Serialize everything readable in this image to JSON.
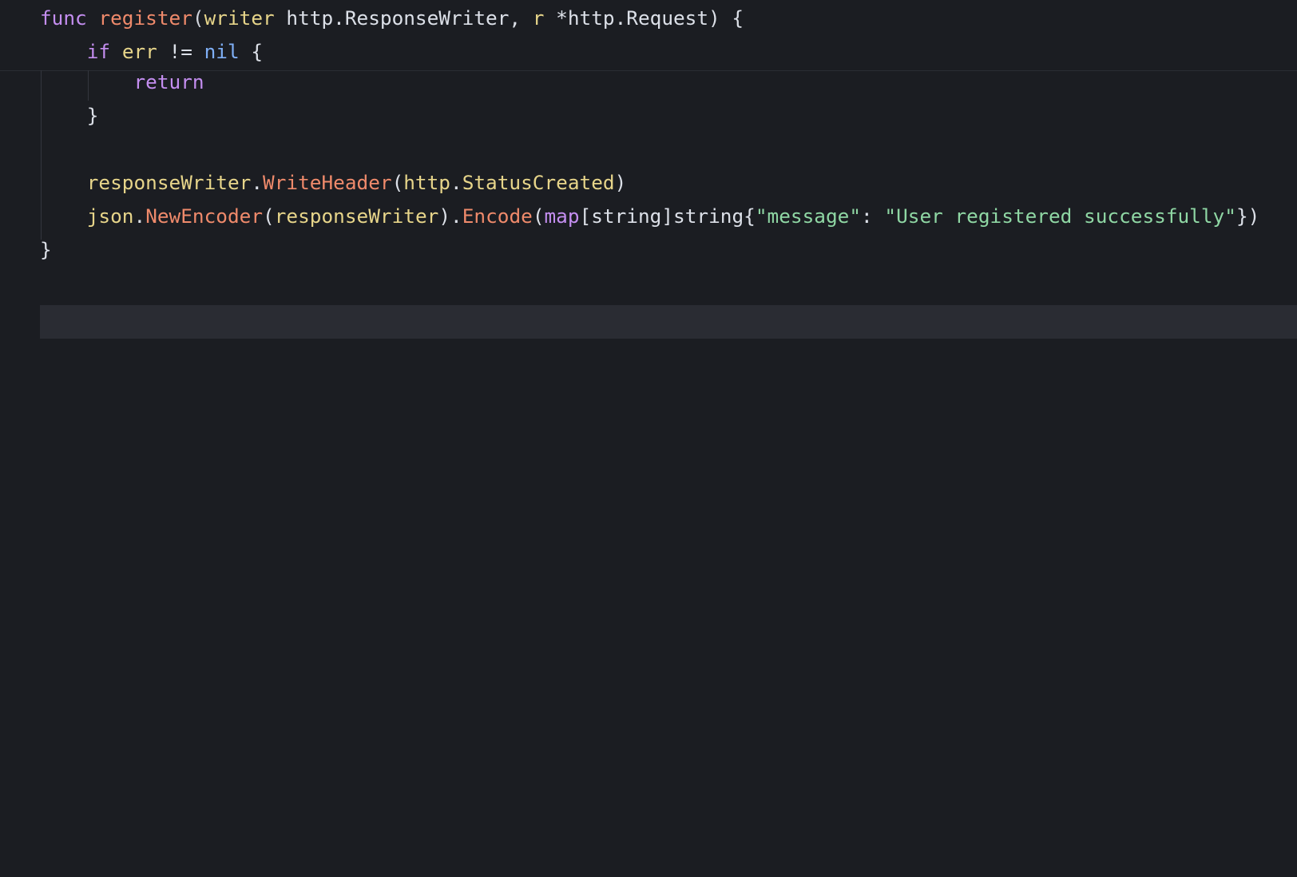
{
  "editor": {
    "lines": [
      {
        "tokens": [
          {
            "text": "func",
            "kind": "kw"
          },
          {
            "text": " ",
            "kind": "punct"
          },
          {
            "text": "register",
            "kind": "fn"
          },
          {
            "text": "(",
            "kind": "punct"
          },
          {
            "text": "writer",
            "kind": "param"
          },
          {
            "text": " http.ResponseWriter, ",
            "kind": "ident"
          },
          {
            "text": "r",
            "kind": "param"
          },
          {
            "text": " *http.Request) {",
            "kind": "ident"
          }
        ]
      },
      {
        "tokens": [
          {
            "text": "    ",
            "kind": "punct"
          },
          {
            "text": "if",
            "kind": "kw"
          },
          {
            "text": " ",
            "kind": "punct"
          },
          {
            "text": "err",
            "kind": "param"
          },
          {
            "text": " != ",
            "kind": "ident"
          },
          {
            "text": "nil",
            "kind": "nil"
          },
          {
            "text": " {",
            "kind": "ident"
          }
        ]
      },
      {
        "tokens": [
          {
            "text": "        ",
            "kind": "punct"
          },
          {
            "text": "return",
            "kind": "kw"
          }
        ]
      },
      {
        "tokens": [
          {
            "text": "    }",
            "kind": "ident"
          }
        ]
      },
      {
        "tokens": []
      },
      {
        "tokens": [
          {
            "text": "    ",
            "kind": "punct"
          },
          {
            "text": "responseWriter",
            "kind": "param"
          },
          {
            "text": ".",
            "kind": "ident"
          },
          {
            "text": "WriteHeader",
            "kind": "fn"
          },
          {
            "text": "(",
            "kind": "ident"
          },
          {
            "text": "http",
            "kind": "param"
          },
          {
            "text": ".",
            "kind": "ident"
          },
          {
            "text": "StatusCreated",
            "kind": "param"
          },
          {
            "text": ")",
            "kind": "ident"
          }
        ]
      },
      {
        "tokens": [
          {
            "text": "    ",
            "kind": "punct"
          },
          {
            "text": "json",
            "kind": "param"
          },
          {
            "text": ".",
            "kind": "ident"
          },
          {
            "text": "NewEncoder",
            "kind": "fn"
          },
          {
            "text": "(",
            "kind": "ident"
          },
          {
            "text": "responseWriter",
            "kind": "param"
          },
          {
            "text": ").",
            "kind": "ident"
          },
          {
            "text": "Encode",
            "kind": "fn"
          },
          {
            "text": "(",
            "kind": "ident"
          },
          {
            "text": "map",
            "kind": "kw"
          },
          {
            "text": "[string]string{",
            "kind": "ident"
          },
          {
            "text": "\"message\"",
            "kind": "str"
          },
          {
            "text": ": ",
            "kind": "ident"
          },
          {
            "text": "\"User registered successfully\"",
            "kind": "str"
          },
          {
            "text": "})",
            "kind": "ident"
          }
        ]
      },
      {
        "tokens": [
          {
            "text": "}",
            "kind": "ident"
          }
        ]
      }
    ],
    "current_line_index": 9,
    "colors": {
      "background": "#1b1d22",
      "keyword": "#c48ef0",
      "nil": "#7faff6",
      "function": "#ef8a6b",
      "parameter": "#e7d58a",
      "identifier": "#dce0e8",
      "string": "#8fd7a4",
      "current_line": "#2a2c33"
    }
  }
}
